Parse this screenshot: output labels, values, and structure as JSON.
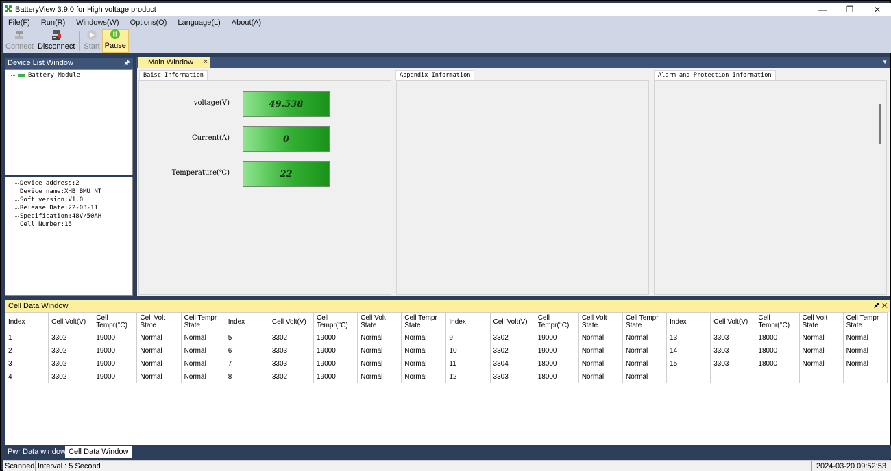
{
  "window": {
    "title": "BatteryView 3.9.0 for High voltage product",
    "controls": {
      "minimize": "—",
      "restore": "❐",
      "close": "✕"
    }
  },
  "menu": [
    "File(F)",
    "Run(R)",
    "Windows(W)",
    "Options(O)",
    "Language(L)",
    "About(A)"
  ],
  "toolbar": {
    "connect": "Connect",
    "disconnect": "Disconnect",
    "start": "Start",
    "pause": "Pause"
  },
  "device_list": {
    "title": "Device List Window",
    "pin": "🖈",
    "tree_item": "Battery Module",
    "info": [
      "Device address:2",
      "Device name:XHB_BMU_NT",
      "Soft  version:V1.0",
      "Release Date:22-03-11",
      "Specification:48V/50AH",
      "Cell Number:15"
    ]
  },
  "main_window": {
    "tab_label": "Main Window",
    "tab_close": "×",
    "dropdown": "▼",
    "sections": {
      "basic": "Baisc Information",
      "appendix": "Appendix Information",
      "alarm": "Alarm and Protection Information"
    },
    "params": [
      {
        "label": "voltage(V)",
        "value": "49.538"
      },
      {
        "label": "Current(A)",
        "value": "0"
      },
      {
        "label": "Temperature(℃)",
        "value": "22"
      }
    ]
  },
  "cell_data": {
    "title": "Cell Data Window",
    "icons": "🖈 ✕",
    "headers": [
      "Index",
      "Cell Volt(V)",
      "Cell Tempr(°C)",
      "Cell Volt State",
      "Cell Tempr State"
    ],
    "rows": [
      [
        "1",
        "3302",
        "19000",
        "Normal",
        "Normal",
        "5",
        "3302",
        "19000",
        "Normal",
        "Normal",
        "9",
        "3302",
        "19000",
        "Normal",
        "Normal",
        "13",
        "3303",
        "18000",
        "Normal",
        "Normal"
      ],
      [
        "2",
        "3302",
        "19000",
        "Normal",
        "Normal",
        "6",
        "3303",
        "19000",
        "Normal",
        "Normal",
        "10",
        "3302",
        "19000",
        "Normal",
        "Normal",
        "14",
        "3303",
        "18000",
        "Normal",
        "Normal"
      ],
      [
        "3",
        "3302",
        "19000",
        "Normal",
        "Normal",
        "7",
        "3303",
        "19000",
        "Normal",
        "Normal",
        "11",
        "3304",
        "18000",
        "Normal",
        "Normal",
        "15",
        "3303",
        "18000",
        "Normal",
        "Normal"
      ],
      [
        "4",
        "3302",
        "19000",
        "Normal",
        "Normal",
        "8",
        "3302",
        "19000",
        "Normal",
        "Normal",
        "12",
        "3303",
        "18000",
        "Normal",
        "Normal",
        "",
        "",
        "",
        "",
        ""
      ]
    ]
  },
  "bottom_tabs": [
    "Pwr Data window",
    "Cell Data Window"
  ],
  "status": {
    "scanned": "Scanned.",
    "interval": "Interval : 5  Second",
    "datetime": "2024-03-20 09:52:53"
  },
  "colors": {
    "frame": "#2c3e5a",
    "panel_header": "#3d5478",
    "active_tab": "#fcef9d",
    "value_box": "#33b133"
  }
}
